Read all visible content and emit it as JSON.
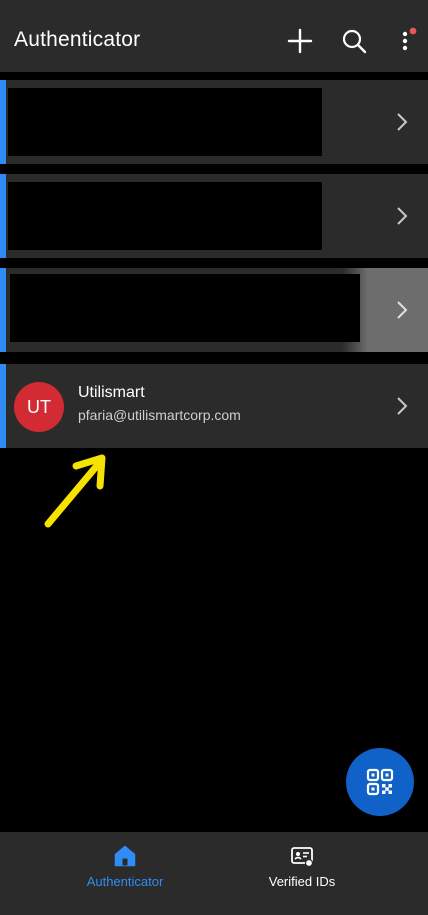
{
  "header": {
    "title": "Authenticator",
    "add_icon": "plus-icon",
    "search_icon": "search-icon",
    "more_icon": "more-vertical-icon",
    "notification_dot_color": "#e8555b"
  },
  "accounts": {
    "items": [
      {
        "redacted": true
      },
      {
        "redacted": true
      },
      {
        "redacted": true
      },
      {
        "avatar_initials": "UT",
        "avatar_color": "#d22b34",
        "name": "Utilismart",
        "email": "pfaria@utilismartcorp.com"
      }
    ],
    "accent_color": "#2f8cf4"
  },
  "fab": {
    "icon": "qr-code-icon",
    "color": "#1062c8"
  },
  "bottom_nav": {
    "items": [
      {
        "label": "Authenticator",
        "icon": "home-icon",
        "active": true
      },
      {
        "label": "Verified IDs",
        "icon": "id-card-icon",
        "active": false
      }
    ],
    "active_color": "#2f8cf4"
  },
  "annotation": {
    "type": "arrow",
    "color": "#f5e200"
  }
}
